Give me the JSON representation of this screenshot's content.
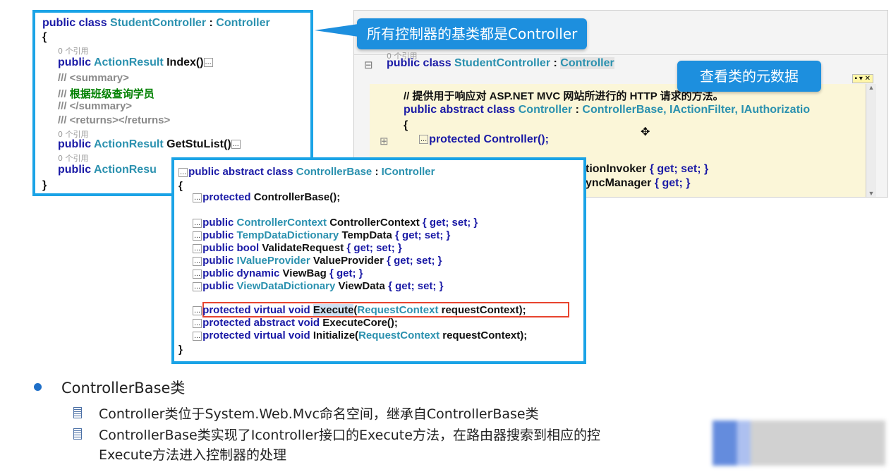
{
  "panel_student": {
    "line1": {
      "kw": "public class",
      "name": "StudentController",
      "sep": " : ",
      "base": "Controller"
    },
    "brace_open": "{",
    "ref1": "0 个引用",
    "index": {
      "kw": "public",
      "type": "ActionResult",
      "rest": "Index()",
      "ellipsis": "..."
    },
    "sum1": "/// <summary>",
    "comment_prefix": "///",
    "comment_cn": "根据班级查询学员",
    "sum2": "/// </summary>",
    "returns": "/// <returns></returns>",
    "ref2": "0 个引用",
    "getstu": {
      "kw": "public",
      "type": "ActionResult",
      "rest": "GetStuList()",
      "ellipsis": "..."
    },
    "ref3": "0 个引用",
    "last": {
      "kw": "public",
      "type": "ActionResu"
    },
    "brace_close": "}"
  },
  "panel_meta": {
    "ref": "0 个引用",
    "class_line": {
      "kw": "public class",
      "name": "StudentController",
      "sep": " : ",
      "base": "Controller"
    },
    "comment": "//   提供用于响应对 ASP.NET MVC 网站所进行的 HTTP 请求的方法。",
    "decl": {
      "kw": "public abstract class",
      "name": "Controller",
      "sep": " : ",
      "bases": "ControllerBase, IActionFilter, IAuthorizatio"
    },
    "brace": "{",
    "ctor": {
      "ellipsis": "...",
      "text": "protected Controller();"
    },
    "prop1": {
      "text": "tionInvoker",
      "acc": "{ get; set; }"
    },
    "prop2": {
      "text": "yncManager",
      "acc": "{ get; }"
    }
  },
  "panel_base": {
    "header": {
      "ellipsis": "...",
      "kw": "public abstract class",
      "name": "ControllerBase",
      "sep": " : ",
      "base": "IController"
    },
    "brace_open": "{",
    "ctor": {
      "ellipsis": "...",
      "kw": "protected",
      "rest": "ControllerBase();"
    },
    "props": [
      {
        "kw": "public",
        "type": "ControllerContext",
        "name": "ControllerContext",
        "acc": "{ get; set; }"
      },
      {
        "kw": "public",
        "type": "TempDataDictionary",
        "name": "TempData",
        "acc": "{ get; set; }"
      },
      {
        "kw": "public bool",
        "type": "",
        "name": "ValidateRequest",
        "acc": "{ get; set; }"
      },
      {
        "kw": "public",
        "type": "IValueProvider",
        "name": "ValueProvider",
        "acc": "{ get; set; }"
      },
      {
        "kw": "public dynamic",
        "type": "",
        "name": "ViewBag",
        "acc": "{ get; }"
      },
      {
        "kw": "public",
        "type": "ViewDataDictionary",
        "name": "ViewData",
        "acc": "{ get; set; }"
      }
    ],
    "execute": {
      "kw": "protected virtual void",
      "name": "Execute",
      "open": "(",
      "type": "RequestContext",
      "rest": " requestContext);"
    },
    "execcore": {
      "kw": "protected abstract void",
      "rest": "ExecuteCore();"
    },
    "init": {
      "kw": "protected virtual void",
      "name": "Initialize(",
      "type": "RequestContext",
      "rest": " requestContext);"
    },
    "ellipsis": "...",
    "brace_close": "}"
  },
  "callouts": {
    "base_class": "所有控制器的基类都是Controller",
    "metadata": "查看类的元数据"
  },
  "bullets": {
    "heading": "ControllerBase类",
    "items": [
      "Controller类位于System.Web.Mvc命名空间，继承自ControllerBase类",
      "ControllerBase类实现了Icontroller接口的Execute方法，在路由器搜索到相应的控",
      "Execute方法进入控制器的处理"
    ]
  },
  "colors": {
    "accent": "#1aa3e6",
    "highlight_box": "#e8442e",
    "keyword": "#1a1aa6",
    "type": "#2b91af",
    "comment": "#008000"
  }
}
